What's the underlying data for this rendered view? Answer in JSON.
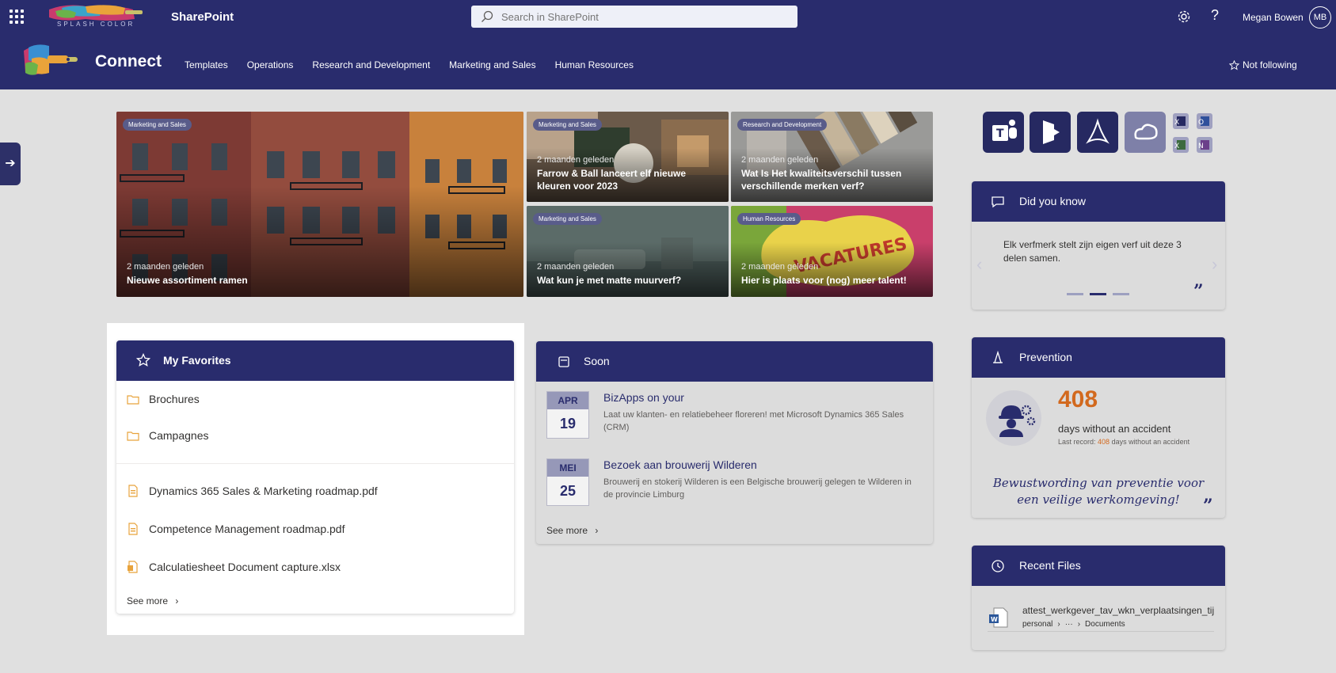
{
  "suite": {
    "app_name": "SharePoint",
    "logo_text": "SPLASH COLOR",
    "search_placeholder": "Search in SharePoint",
    "user_name": "Megan Bowen",
    "user_initials": "MB"
  },
  "site": {
    "title": "Connect",
    "nav": [
      "Templates",
      "Operations",
      "Research and Development",
      "Marketing and Sales",
      "Human Resources"
    ],
    "follow_label": "Not following"
  },
  "hero": [
    {
      "category": "Marketing and Sales",
      "ago": "2 maanden geleden",
      "title": "Nieuwe assortiment ramen"
    },
    {
      "category": "Marketing and Sales",
      "ago": "2 maanden geleden",
      "title": "Farrow & Ball lanceert elf nieuwe kleuren voor 2023"
    },
    {
      "category": "Research and Development",
      "ago": "2 maanden geleden",
      "title": "Wat Is Het kwaliteitsverschil tussen verschillende merken verf?"
    },
    {
      "category": "Marketing and Sales",
      "ago": "2 maanden geleden",
      "title": "Wat kun je met matte muurverf?"
    },
    {
      "category": "Human Resources",
      "ago": "2 maanden geleden",
      "title": "Hier is plaats voor (nog) meer talent!",
      "overlay_text": "VACATURES"
    }
  ],
  "favorites": {
    "title": "My Favorites",
    "folders": [
      "Brochures",
      "Campagnes"
    ],
    "files": [
      "Dynamics 365 Sales & Marketing roadmap.pdf",
      "Competence Management roadmap.pdf",
      "Calculatiesheet Document capture.xlsx"
    ],
    "see_more": "See more"
  },
  "soon": {
    "title": "Soon",
    "items": [
      {
        "month": "APR",
        "day": "19",
        "title": "BizApps on your",
        "desc": "Laat uw klanten- en relatiebeheer floreren! met Microsoft Dynamics 365 Sales (CRM)"
      },
      {
        "month": "MEI",
        "day": "25",
        "title": "Bezoek aan brouwerij Wilderen",
        "desc": "Brouwerij en stokerij Wilderen is een Belgische brouwerij gelegen te Wilderen in de provincie Limburg"
      }
    ],
    "see_more": "See more"
  },
  "did_you_know": {
    "title": "Did you know",
    "text": "Elk verfmerk stelt zijn eigen verf uit deze 3 delen samen.",
    "active_dot": 2
  },
  "prevention": {
    "title": "Prevention",
    "count": "408",
    "label": "days without an accident",
    "record_label": "Last record:",
    "record_value": "408",
    "record_suffix": "days without an accident",
    "quote": "Bewustwording van preventie voor een veilige werkomgeving!"
  },
  "recent_files": {
    "title": "Recent Files",
    "items": [
      {
        "name": "attest_werkgever_tav_wkn_verplaatsingen_tij",
        "path_start": "personal",
        "path_ellipsis": "···",
        "path_end": "Documents"
      }
    ]
  },
  "colors": {
    "brand": "#292c6d",
    "accent_orange": "#d2691e"
  }
}
